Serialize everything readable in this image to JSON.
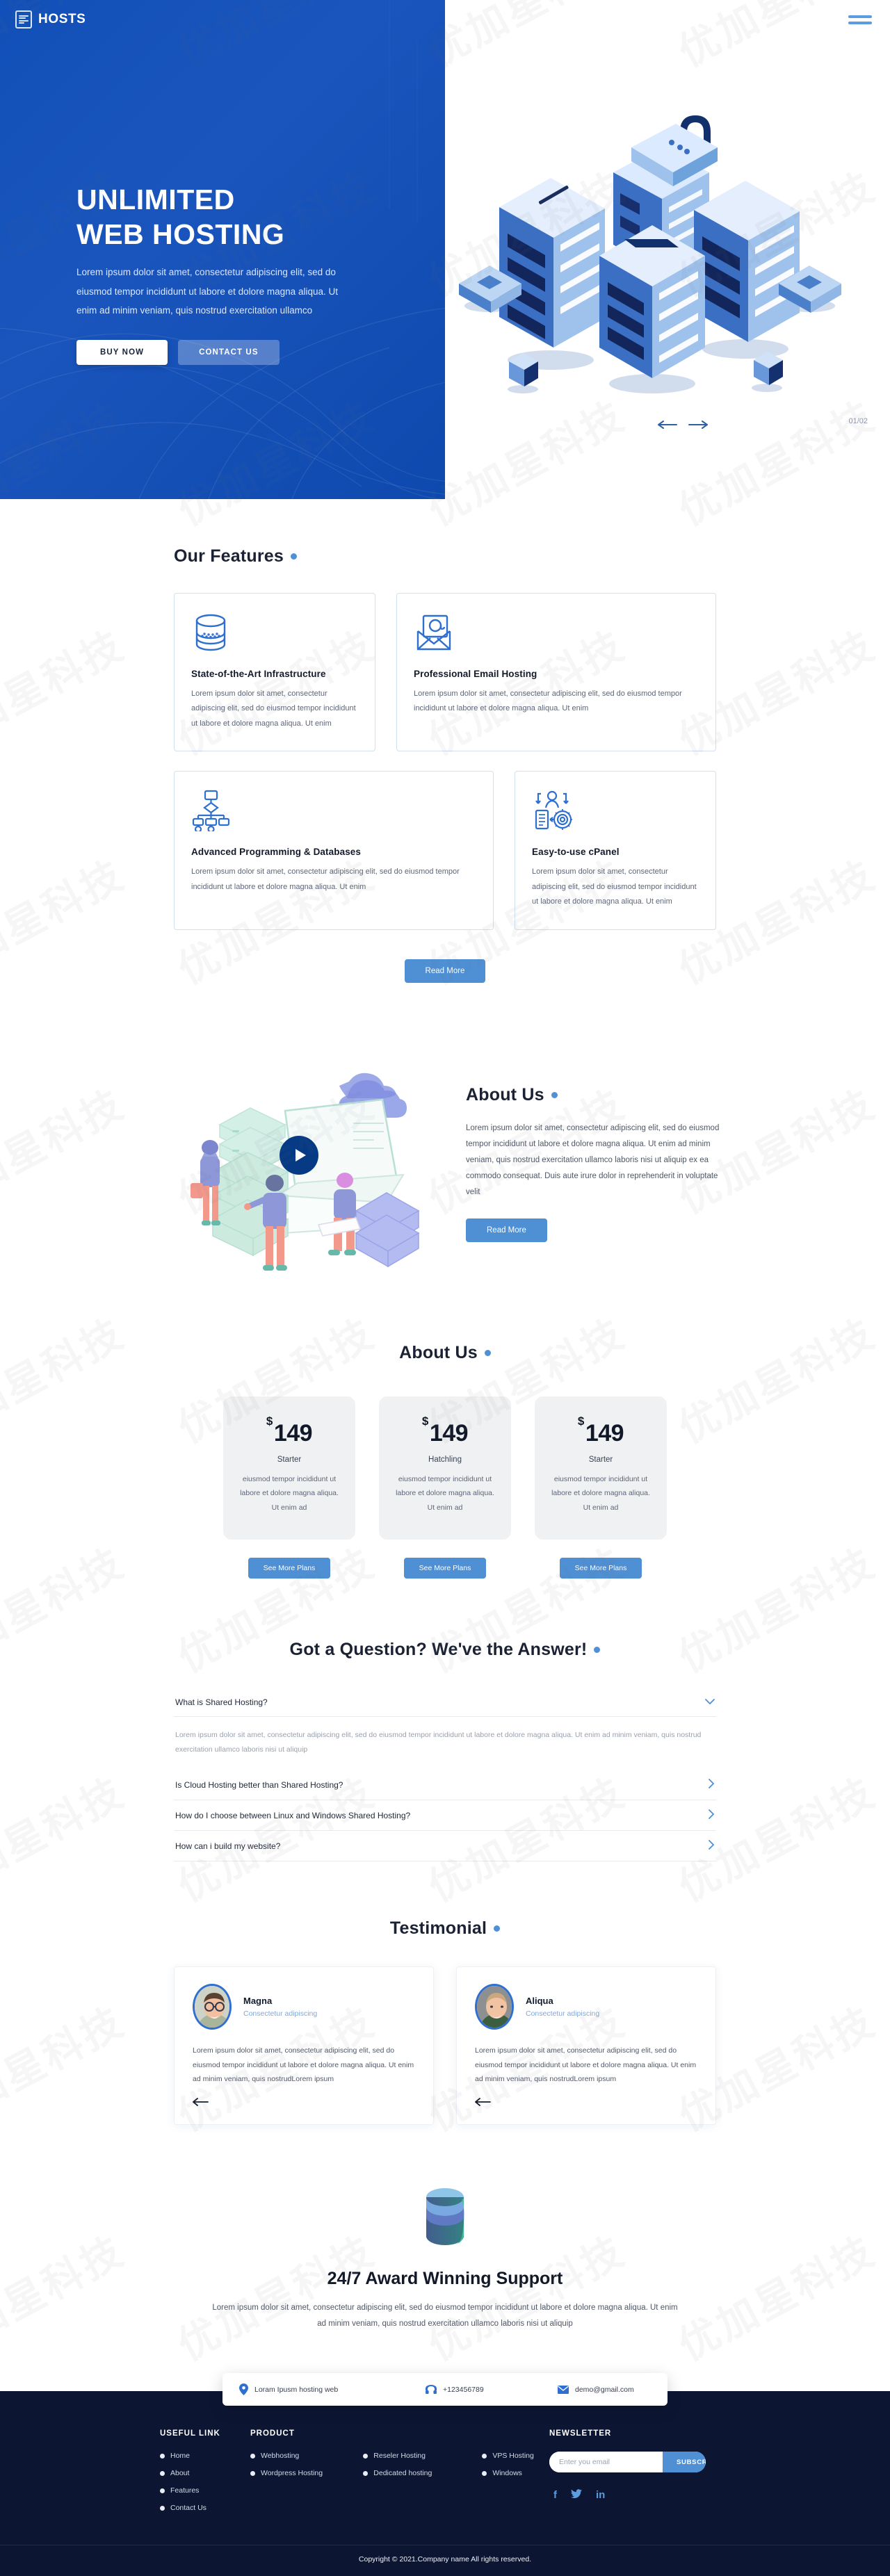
{
  "header": {
    "brand": "HOSTS",
    "brand_icon": "server-rack-icon",
    "menu_icon": "hamburger-menu-icon"
  },
  "hero": {
    "title_line1": "UNLIMITED",
    "title_line2": "WEB HOSTING",
    "paragraph": "Lorem ipsum dolor sit amet, consectetur adipiscing elit, sed do eiusmod tempor incididunt ut labore et dolore magna aliqua. Ut enim ad minim veniam, quis nostrud exercitation ullamco",
    "buy_label": "BUY NOW",
    "contact_label": "CONTACT US",
    "slide_counter": "01/02",
    "prev_icon": "arrow-left-icon",
    "next_icon": "arrow-right-icon",
    "illustration": "isometric-server-racks-illustration",
    "accent": "#1150b8"
  },
  "features": {
    "title": "Our Features",
    "read_more": "Read More",
    "cards": [
      {
        "icon": "database-icon",
        "title": "State-of-the-Art Infrastructure",
        "body": "Lorem ipsum dolor sit amet, consectetur adipiscing elit, sed do eiusmod tempor incididunt ut labore et dolore magna aliqua. Ut enim"
      },
      {
        "icon": "email-envelope-icon",
        "title": "Professional Email Hosting",
        "body": "Lorem ipsum dolor sit amet, consectetur adipiscing elit, sed do eiusmod tempor incididunt ut labore et dolore magna aliqua. Ut enim"
      },
      {
        "icon": "network-diagram-icon",
        "title": "Advanced Programming & Databases",
        "body": "Lorem ipsum dolor sit amet, consectetur adipiscing elit, sed do eiusmod tempor incididunt ut labore et dolore magna aliqua. Ut enim"
      },
      {
        "icon": "cpanel-user-settings-icon",
        "title": "Easy-to-use cPanel",
        "body": "Lorem ipsum dolor sit amet, consectetur adipiscing elit, sed do eiusmod tempor incididunt ut labore et dolore magna aliqua. Ut enim"
      }
    ]
  },
  "about": {
    "title": "About Us",
    "paragraph": "Lorem ipsum dolor sit amet, consectetur adipiscing elit, sed do eiusmod tempor incididunt ut labore et dolore magna aliqua. Ut enim ad minim veniam, quis nostrud exercitation ullamco laboris nisi ut aliquip ex ea commodo consequat. Duis aute irure dolor in reprehenderit in voluptate velit",
    "read_more": "Read More",
    "illustration": "isometric-team-servers-cloud-illustration",
    "play_icon": "play-button-icon"
  },
  "pricing": {
    "title": "About Us",
    "plans": [
      {
        "currency": "$",
        "amount": "149",
        "name": "Starter",
        "desc": "eiusmod tempor incididunt ut labore et dolore magna aliqua. Ut enim ad",
        "cta": "See More Plans"
      },
      {
        "currency": "$",
        "amount": "149",
        "name": "Hatchling",
        "desc": "eiusmod tempor incididunt ut labore et dolore magna aliqua. Ut enim ad",
        "cta": "See More Plans"
      },
      {
        "currency": "$",
        "amount": "149",
        "name": "Starter",
        "desc": "eiusmod tempor incididunt ut labore et dolore magna aliqua. Ut enim ad",
        "cta": "See More Plans"
      }
    ]
  },
  "faq": {
    "title": "Got a Question? We've the Answer!",
    "items": [
      {
        "question": "What is Shared Hosting?",
        "answer": "Lorem ipsum dolor sit amet, consectetur adipiscing elit, sed do eiusmod tempor incididunt ut labore et dolore magna aliqua. Ut enim ad minim veniam, quis nostrud exercitation ullamco laboris nisi ut aliquip",
        "open": true,
        "icon": "chevron-down-icon"
      },
      {
        "question": "Is Cloud Hosting better than Shared Hosting?",
        "open": false,
        "icon": "chevron-right-icon"
      },
      {
        "question": "How do I choose between Linux and Windows Shared Hosting?",
        "open": false,
        "icon": "chevron-right-icon"
      },
      {
        "question": "How can i build my website?",
        "open": false,
        "icon": "chevron-right-icon"
      }
    ]
  },
  "testimonial": {
    "title": "Testimonial",
    "items": [
      {
        "name": "Magna",
        "role": "Consectetur adipiscing",
        "body": "Lorem ipsum dolor sit amet, consectetur adipiscing elit, sed do eiusmod tempor incididunt ut labore et dolore magna aliqua. Ut enim ad minim veniam, quis nostrudLorem ipsum",
        "avatar": "man-with-glasses-avatar",
        "prev_icon": "arrow-left-icon"
      },
      {
        "name": "Aliqua",
        "role": "Consectetur adipiscing",
        "body": "Lorem ipsum dolor sit amet, consectetur adipiscing elit, sed do eiusmod tempor incididunt ut labore et dolore magna aliqua. Ut enim ad minim veniam, quis nostrudLorem ipsum",
        "avatar": "smiling-man-avatar",
        "prev_icon": "arrow-left-icon"
      }
    ]
  },
  "support": {
    "icon": "database-cylinder-icon",
    "title": "24/7 Award Winning Support",
    "paragraph": "Lorem ipsum dolor sit amet, consectetur adipiscing elit, sed do eiusmod tempor incididunt ut labore et dolore magna aliqua. Ut enim ad minim veniam, quis nostrud exercitation ullamco laboris nisi ut aliquip"
  },
  "footer": {
    "contact": [
      {
        "icon": "location-pin-icon",
        "text": "Loram Ipusm hosting web"
      },
      {
        "icon": "telephone-icon",
        "text": "+123456789"
      },
      {
        "icon": "envelope-icon",
        "text": "demo@gmail.com"
      }
    ],
    "useful_title": "USEFUL LINK",
    "useful_links": [
      "Home",
      "About",
      "Features",
      "Contact Us"
    ],
    "product_title": "PRODUCT",
    "product_col1": [
      "Webhosting",
      "Wordpress Hosting"
    ],
    "product_col2": [
      "Reseler Hosting",
      "Dedicated hosting"
    ],
    "product_col3": [
      "VPS Hosting",
      "Windows"
    ],
    "newsletter_title": "NEWSLETTER",
    "newsletter_placeholder": "Enter you email",
    "newsletter_value": "",
    "subscribe_label": "SUBSCRIBE",
    "socials": [
      {
        "icon": "facebook-icon",
        "glyph": "f"
      },
      {
        "icon": "twitter-icon",
        "glyph": "🐦"
      },
      {
        "icon": "linkedin-icon",
        "glyph": "in"
      }
    ],
    "copyright": "Copyright © 2021.Company name All rights reserved.",
    "bg": "#0c1633"
  },
  "watermark": {
    "text": "优加星科技"
  }
}
